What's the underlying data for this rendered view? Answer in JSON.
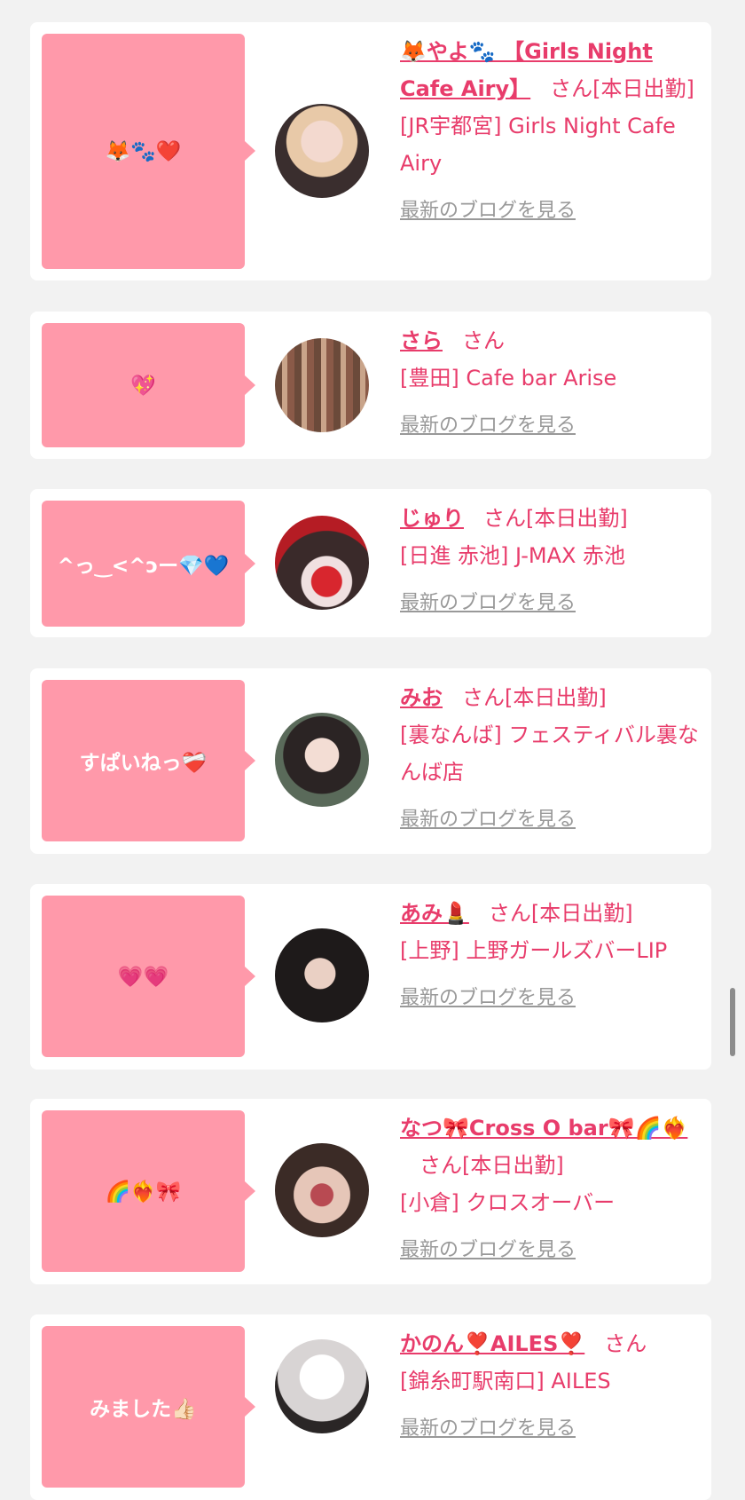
{
  "cards": [
    {
      "bubble": "🦊🐾❤️",
      "name": "🦊やよ🐾 【Girls Night Cafe Airy】",
      "san": "さん",
      "status": "[本日出勤]",
      "shop": "[JR宇都宮] Girls Night Cafe Airy",
      "blog": "最新のブログを見る"
    },
    {
      "bubble": "💖",
      "name": "さら",
      "san": "さん",
      "status": "",
      "shop": "[豊田] Cafe bar Arise",
      "blog": "最新のブログを見る"
    },
    {
      "bubble": "^っ‿<^ɔー💎💙",
      "name": "じゅり",
      "san": "さん",
      "status": "[本日出勤]",
      "shop": "[日進 赤池] J-MAX 赤池",
      "blog": "最新のブログを見る"
    },
    {
      "bubble": "すぱいねっ❤️‍🩹",
      "name": "みお",
      "san": "さん",
      "status": "[本日出勤]",
      "shop": "[裏なんば] フェスティバル裏なんば店",
      "blog": "最新のブログを見る"
    },
    {
      "bubble": "💗💗",
      "name": "あみ💄",
      "san": "さん",
      "status": "[本日出勤]",
      "shop": "[上野] 上野ガールズバーLIP",
      "blog": "最新のブログを見る"
    },
    {
      "bubble": "🌈❤️‍🔥🎀",
      "name": "なつ🎀Cross O bar🎀🌈❤️‍🔥",
      "san": "さん",
      "status": "[本日出勤]",
      "shop": "[小倉] クロスオーバー",
      "blog": "最新のブログを見る"
    },
    {
      "bubble": "みました👍🏻",
      "name": "かのん❣️AILES❣️",
      "san": "さん",
      "status": "",
      "shop": "[錦糸町駅南口] AILES",
      "blog": "最新のブログを見る"
    }
  ],
  "colors": {
    "accent": "#e83c6b",
    "bubble": "#ff99aa",
    "link_gray": "#999999",
    "background": "#f2f2f2"
  },
  "avatar_icon": "profile-photo"
}
